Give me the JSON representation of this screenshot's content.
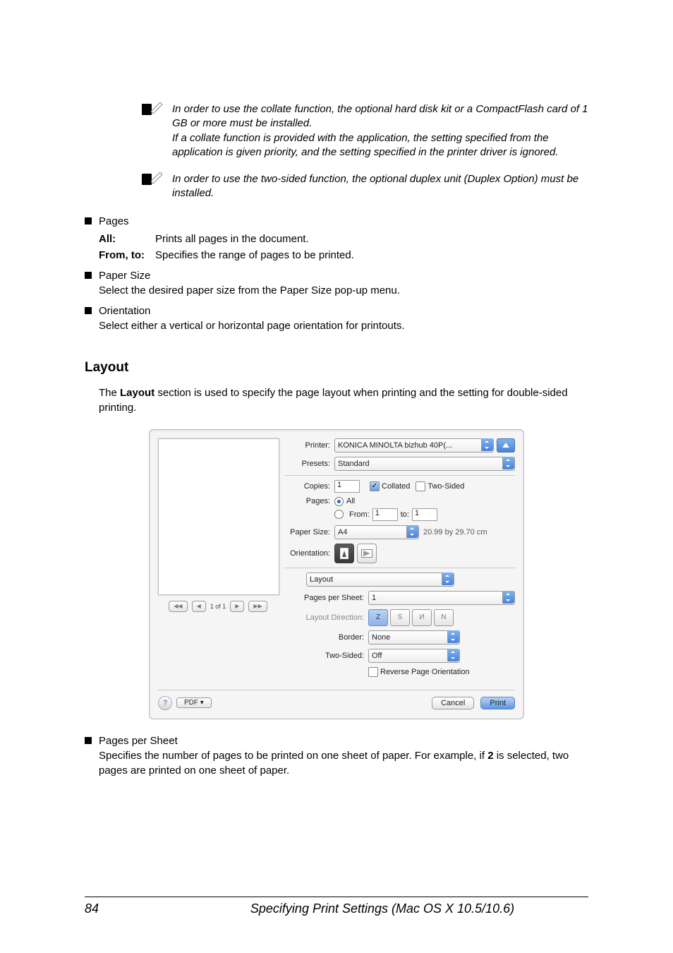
{
  "notes": {
    "n1": "In order to use the collate function, the optional hard disk kit or a CompactFlash card of 1 GB or more must be installed.\nIf a collate function is provided with the application, the setting specified from the application is given priority, and the setting specified in the printer driver is ignored.",
    "n2": "In order to use the two-sided function, the optional duplex unit (Duplex Option) must be installed."
  },
  "bullets": {
    "pages_title": "Pages",
    "pages_all_term": "All",
    "pages_all_desc": "Prints all pages in the document.",
    "pages_fromto_term": "From, to",
    "pages_fromto_desc": "Specifies the range of pages to be printed.",
    "papersize_title": "Paper Size",
    "papersize_desc": "Select the desired paper size from the Paper Size pop-up menu.",
    "orientation_title": "Orientation",
    "orientation_desc": "Select either a vertical or horizontal page orientation for printouts.",
    "pps_title": "Pages per Sheet",
    "pps_desc_a": "Specifies the number of pages to be printed on one sheet of paper. For example, if ",
    "pps_desc_bold": "2",
    "pps_desc_b": " is selected, two pages are printed on one sheet of paper."
  },
  "heading": "Layout",
  "para_a": "The ",
  "para_bold": "Layout",
  "para_b": " section is used to specify the page layout when printing and the setting for double-sided printing.",
  "dialog": {
    "printer_label": "Printer:",
    "printer_value": "KONICA MINOLTA bizhub 40P(...",
    "presets_label": "Presets:",
    "presets_value": "Standard",
    "copies_label": "Copies:",
    "copies_value": "1",
    "collated_label": "Collated",
    "twosided_label": "Two-Sided",
    "pages_label": "Pages:",
    "pages_all": "All",
    "pages_from": "From:",
    "pages_from_v": "1",
    "pages_to": "to:",
    "pages_to_v": "1",
    "papersize_label": "Paper Size:",
    "papersize_value": "A4",
    "papersize_dim": "20.99 by 29.70 cm",
    "orientation_label": "Orientation:",
    "section_value": "Layout",
    "pps_label": "Pages per Sheet:",
    "pps_value": "1",
    "layoutdir_label": "Layout Direction:",
    "border_label": "Border:",
    "border_value": "None",
    "ts_label": "Two-Sided:",
    "ts_value": "Off",
    "reverse_label": "Reverse Page Orientation",
    "nav_prevprev": "◀◀",
    "nav_prev": "◀",
    "nav_pos": "1 of 1",
    "nav_next": "▶",
    "nav_nextnext": "▶▶",
    "help": "?",
    "pdf": "PDF ▾",
    "cancel": "Cancel",
    "print": "Print"
  },
  "footer": {
    "page": "84",
    "title": "Specifying Print Settings (Mac OS X 10.5/10.6)"
  }
}
